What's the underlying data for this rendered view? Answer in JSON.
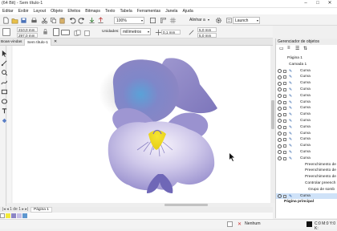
{
  "titlebar": {
    "text": "(64 Bit) - Sem título-1"
  },
  "menu": [
    "Editar",
    "Exibir",
    "Layout",
    "Objeto",
    "Efeitos",
    "Bitmaps",
    "Texto",
    "Tabela",
    "Ferramentas",
    "Janela",
    "Ajuda"
  ],
  "toolbar1": {
    "zoom": "100%",
    "snap": "Alinhar a",
    "launch": "Launch"
  },
  "propbar": {
    "width": "210,0 mm",
    "height": "297,0 mm",
    "units_label": "Unidades:",
    "units": "milímetros",
    "nudge": "0,1 mm",
    "dup_x": "5,0 mm",
    "dup_y": "5,0 mm"
  },
  "tabs": {
    "welcome": "Boas-vindas",
    "doc": "Sem título-1"
  },
  "pagebar": {
    "page": "Página 1"
  },
  "docker": {
    "title": "Gerenciador de objetos",
    "page": "Página 1",
    "layer": "Camada 1",
    "items": [
      "Curva",
      "Curva",
      "Curva",
      "Curva",
      "Curva",
      "Curva",
      "Curva",
      "Curva",
      "Curva",
      "Curva",
      "Curva",
      "Curva",
      "Curva",
      "Curva",
      "Curva",
      "Preenchimento de",
      "Preenchimento de",
      "Preenchimento de",
      "Controlar preench",
      "Grupo de somb",
      "Curva"
    ],
    "master": "Página principal"
  },
  "status": {
    "fill": "Nenhum",
    "color": "C:0 M:0 Y:0 K:"
  },
  "colors": {
    "accent": "#2b5fa8",
    "selection": "#cfe2f8"
  }
}
